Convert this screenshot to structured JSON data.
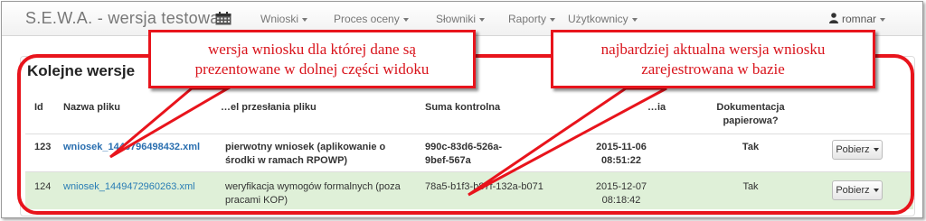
{
  "app": {
    "title": "S.E.W.A. - wersja testowa"
  },
  "nav": {
    "items": [
      "Wnioski",
      "Proces oceny",
      "Słowniki",
      "Raporty",
      "Użytkownicy"
    ],
    "user": "romnar"
  },
  "panel": {
    "title": "Kolejne wersje"
  },
  "table": {
    "headers": {
      "id": "Id",
      "file_name": "Nazwa pliku",
      "upload_reason": "…el przesłania pliku",
      "checksum": "Suma kontrolna",
      "date": "…ia",
      "paper_docs_line1": "Dokumentacja",
      "paper_docs_line2": "papierowa?"
    },
    "rows": [
      {
        "id": "123",
        "file": "wniosek_1446796498432.xml",
        "reason_line1": "pierwotny wniosek (aplikowanie o",
        "reason_line2": "środki w ramach RPOWP)",
        "checksum_line1": "990c-83d6-526a-",
        "checksum_line2": "9bef-567a",
        "date_line1": "2015-11-06",
        "date_line2": "08:51:22",
        "paper": "Tak",
        "action": "Pobierz"
      },
      {
        "id": "124",
        "file": "wniosek_1449472960263.xml",
        "reason_line1": "weryfikacja wymogów formalnych (poza",
        "reason_line2": "pracami KOP)",
        "checksum_line1": "78a5-b1f3-b87f-132a-b071",
        "date_line1": "2015-12-07",
        "date_line2": "08:18:42",
        "paper": "Tak",
        "action": "Pobierz"
      }
    ]
  },
  "annotations": {
    "left_line1": "wersja wniosku dla której dane są",
    "left_line2": "prezentowane w dolnej części widoku",
    "right_line1": "najbardziej aktualna  wersja wniosku",
    "right_line2": "zarejestrowana w bazie",
    "color": "#e8141c"
  },
  "colors": {
    "highlight_row": "#dff0d8",
    "link": "#2a7db5",
    "brand": "#777777"
  },
  "icons": {
    "calendar": "calendar-icon",
    "user": "user-icon",
    "caret": "caret-down-icon"
  }
}
